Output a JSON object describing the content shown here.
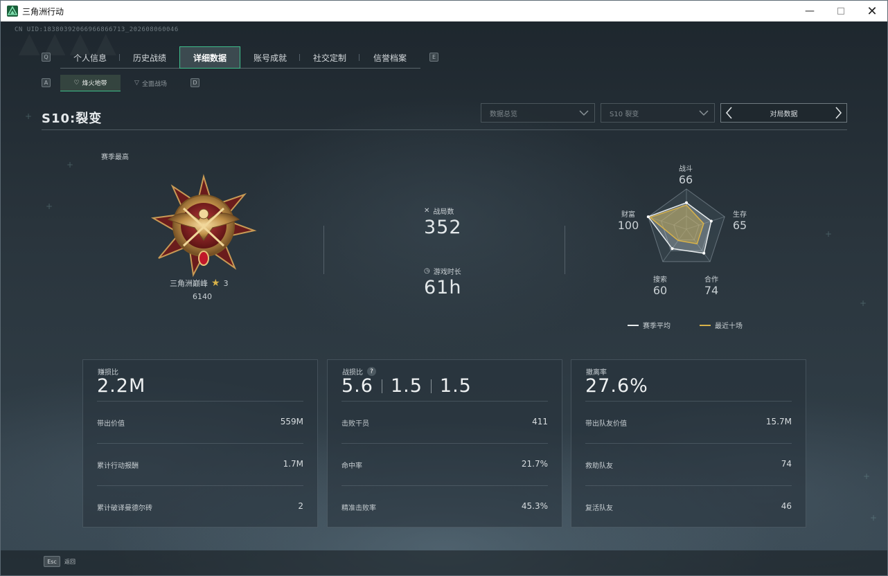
{
  "window": {
    "title": "三角洲行动"
  },
  "header": {
    "uid": "CN UID:18380392066966866713_202608060046"
  },
  "nav": {
    "key_left": "Q",
    "key_right": "E",
    "tabs": [
      {
        "label": "个人信息",
        "active": false
      },
      {
        "label": "历史战绩",
        "active": false
      },
      {
        "label": "详细数据",
        "active": true
      },
      {
        "label": "账号成就",
        "active": false
      },
      {
        "label": "社交定制",
        "active": false
      },
      {
        "label": "信誉档案",
        "active": false
      }
    ]
  },
  "subnav": {
    "key_left": "A",
    "key_right": "D",
    "tabs": [
      {
        "label": "烽火地带",
        "active": true
      },
      {
        "label": "全面战场",
        "active": false
      }
    ]
  },
  "season_title": "S10:裂变",
  "filters": {
    "overview": "数据总览",
    "season": "S10 裂变",
    "pager_label": "对局数据"
  },
  "rank": {
    "section_label": "赛季最高",
    "name": "三角洲巅峰",
    "stars": "3",
    "score": "6140"
  },
  "stats": {
    "matches_label": "战局数",
    "matches": "352",
    "playtime_label": "游戏时长",
    "playtime": "61h"
  },
  "radar": {
    "axes": [
      {
        "label": "战斗",
        "value": "66"
      },
      {
        "label": "生存",
        "value": "65"
      },
      {
        "label": "合作",
        "value": "74"
      },
      {
        "label": "搜索",
        "value": "60"
      },
      {
        "label": "财富",
        "value": "100"
      }
    ],
    "season_avg": [
      66,
      65,
      74,
      60,
      100
    ],
    "recent_ten": [
      60,
      45,
      45,
      35,
      95
    ],
    "legend_avg": "赛季平均",
    "legend_recent": "最近十场",
    "avg_color": "#e8ecee",
    "recent_color": "#d8b24a"
  },
  "cards": [
    {
      "title": "赚损比",
      "values": [
        "2.2M"
      ],
      "rows": [
        {
          "label": "带出价值",
          "value": "559M"
        },
        {
          "label": "累计行动报酬",
          "value": "1.7M"
        },
        {
          "label": "累计破译曼德尔砖",
          "value": "2"
        }
      ]
    },
    {
      "title": "战损比",
      "help": "?",
      "values": [
        "5.6",
        "1.5",
        "1.5"
      ],
      "rows": [
        {
          "label": "击败干员",
          "value": "411"
        },
        {
          "label": "命中率",
          "value": "21.7%"
        },
        {
          "label": "精准击败率",
          "value": "45.3%"
        }
      ]
    },
    {
      "title": "撤离率",
      "values": [
        "27.6%"
      ],
      "rows": [
        {
          "label": "带出队友价值",
          "value": "15.7M"
        },
        {
          "label": "救助队友",
          "value": "74"
        },
        {
          "label": "复活队友",
          "value": "46"
        }
      ]
    }
  ],
  "footer": {
    "esc_key": "Esc",
    "back_label": "返回"
  },
  "icons": {
    "app": "delta-force-icon",
    "minimize": "minimize-icon",
    "maximize": "maximize-icon",
    "close": "close-icon"
  }
}
